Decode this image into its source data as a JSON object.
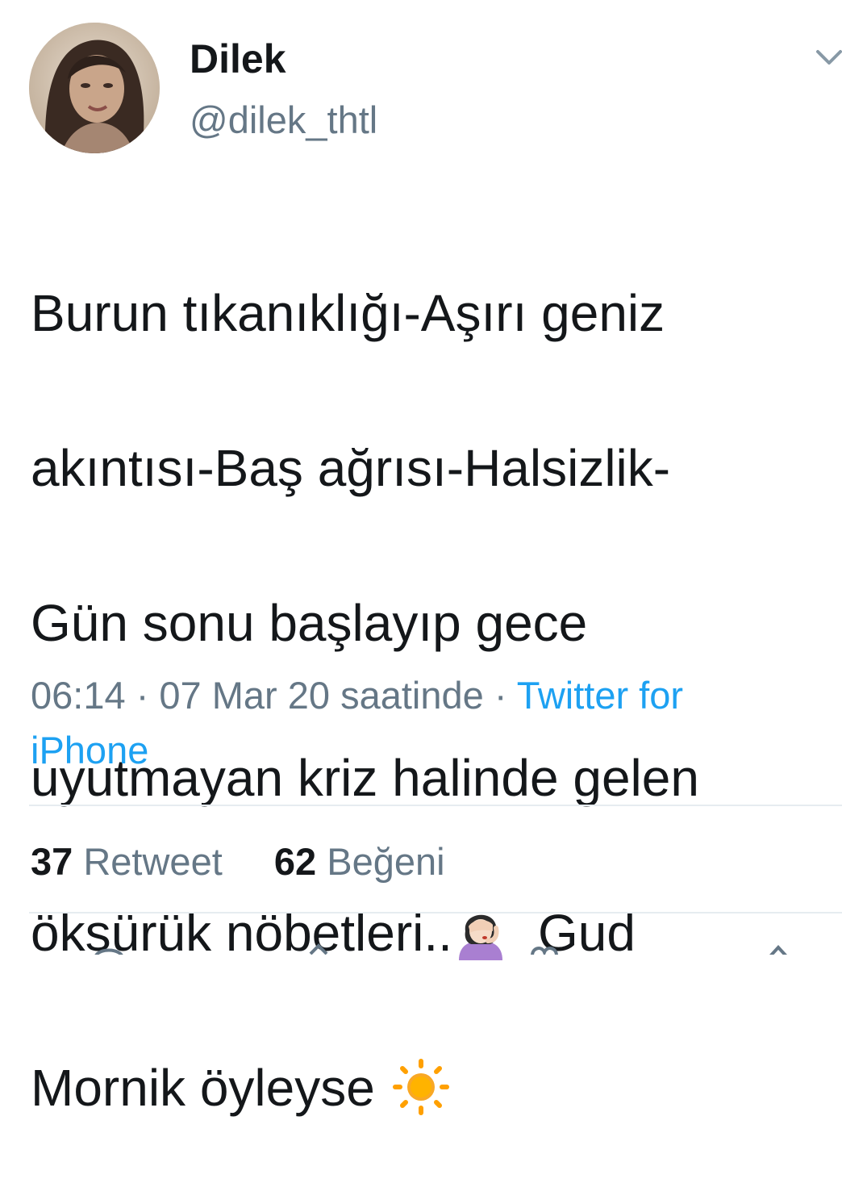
{
  "user": {
    "display_name": "Dilek",
    "handle": "@dilek_thtl",
    "avatar_icon": "profile-photo"
  },
  "tweet": {
    "lines": [
      "Burun tıkanıklığı-Aşırı geniz",
      "akıntısı-Baş ağrısı-Halsizlik-",
      "Gün sonu başlayıp gece",
      "uyutmayan kriz halinde gelen",
      "öksürük nöbetleri..",
      "Gud",
      "Mornik öyleyse"
    ],
    "emoji_1": "woman-facepalming-emoji",
    "emoji_2": "sun-emoji"
  },
  "meta": {
    "time": "06:14",
    "separator": "·",
    "date_text": "07 Mar 20 saatinde",
    "source_line1": "Twitter for",
    "source_line2": "iPhone"
  },
  "stats": {
    "retweets_count": "37",
    "retweets_label": "Retweet",
    "likes_count": "62",
    "likes_label": "Beğeni"
  },
  "colors": {
    "text": "#14171a",
    "secondary": "#657786",
    "link": "#1da1f2",
    "divider": "#e6ecf0"
  }
}
